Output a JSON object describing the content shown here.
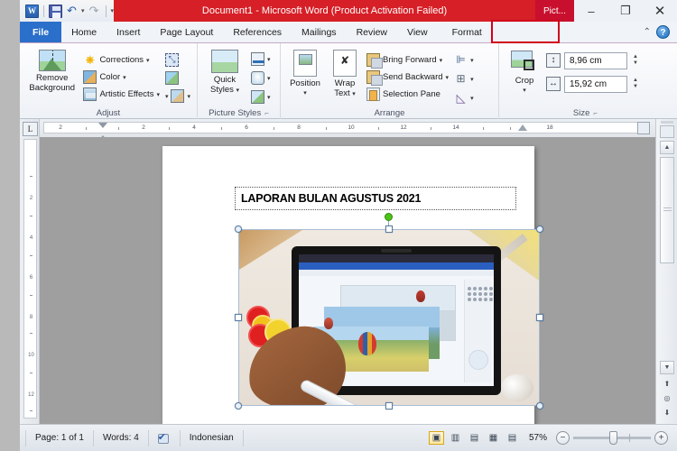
{
  "window": {
    "title": "Document1  -  Microsoft Word (Product Activation Failed)",
    "contextual_tab_group": "Pict...",
    "minimize": "–",
    "maximize": "❐",
    "close": "✕"
  },
  "quick_access": {
    "word_logo": "W",
    "save": "save-icon",
    "undo": "↶",
    "undo_caret": "▾",
    "redo": "↷",
    "customize_caret": "▾"
  },
  "tabs": [
    {
      "label": "File",
      "id": "file"
    },
    {
      "label": "Home",
      "id": "home"
    },
    {
      "label": "Insert",
      "id": "insert"
    },
    {
      "label": "Page Layout",
      "id": "page-layout"
    },
    {
      "label": "References",
      "id": "references"
    },
    {
      "label": "Mailings",
      "id": "mailings"
    },
    {
      "label": "Review",
      "id": "review"
    },
    {
      "label": "View",
      "id": "view"
    },
    {
      "label": "Format",
      "id": "format"
    }
  ],
  "tabstrip_right": {
    "minimize_ribbon": "⌃",
    "help": "?"
  },
  "ribbon": {
    "groups": [
      {
        "label": "Adjust",
        "big_button": "Remove\nBackground",
        "big_button_line1": "Remove",
        "big_button_line2": "Background",
        "items": [
          {
            "label": "Corrections",
            "caret": "▾"
          },
          {
            "label": "Color",
            "caret": "▾"
          },
          {
            "label": "Artistic Effects",
            "caret": "▾"
          }
        ],
        "side_icons": [
          "compress-pictures-icon",
          "change-picture-icon",
          "reset-picture-icon"
        ],
        "side_caret": "▾"
      },
      {
        "label": "Picture Styles",
        "quick_styles_line1": "Quick",
        "quick_styles_line2": "Styles",
        "quick_styles_caret": "▾",
        "side_items": [
          {
            "name": "picture-border",
            "caret": "▾"
          },
          {
            "name": "picture-effects",
            "caret": "▾"
          },
          {
            "name": "picture-layout",
            "caret": "▾"
          }
        ],
        "dialog_launcher": "⌐"
      },
      {
        "label": "Arrange",
        "position_line1": "Position",
        "position_caret": "▾",
        "wrap_line1": "Wrap",
        "wrap_line2": "Text",
        "wrap_caret": "▾",
        "items": [
          {
            "label": "Bring Forward",
            "caret": "▾"
          },
          {
            "label": "Send Backward",
            "caret": "▾"
          },
          {
            "label": "Selection Pane",
            "caret": ""
          }
        ],
        "side_items": [
          {
            "name": "align",
            "caret": "▾"
          },
          {
            "name": "group",
            "caret": "▾"
          },
          {
            "name": "rotate",
            "caret": "▾"
          }
        ]
      },
      {
        "label": "Size",
        "crop_label": "Crop",
        "crop_caret": "▾",
        "height_value": "8,96 cm",
        "width_value": "15,92 cm",
        "spin_up": "▲",
        "spin_down": "▼",
        "dialog_launcher": "⌐"
      }
    ]
  },
  "rulers": {
    "tab_selector": "L",
    "horizontal_ticks": [
      "2",
      "",
      "",
      "2",
      "",
      "4",
      "",
      "6",
      "",
      "8",
      "",
      "10",
      "",
      "12",
      "",
      "14",
      "",
      "",
      "18"
    ],
    "horizontal_labels": [
      "2",
      "2",
      "4",
      "6",
      "8",
      "10",
      "12",
      "14",
      "18"
    ],
    "vertical_labels": [
      "2",
      "4",
      "6",
      "8",
      "10",
      "12"
    ]
  },
  "document": {
    "title_text": "LAPORAN BULAN AGUSTUS 2021",
    "image_alt": "surface-tablet-stylus-hot-air-balloon-photo"
  },
  "scrollbar": {
    "up_arrow": "▲",
    "down_arrow": "▼",
    "previous_page": "⬆",
    "select_browse_object": "◎",
    "next_page": "⬇",
    "browse_object_icon": "select-browse-object-icon"
  },
  "statusbar": {
    "page": "Page: 1 of 1",
    "words": "Words: 4",
    "proofing_icon": "proofing-errors-icon",
    "language": "Indonesian",
    "views": [
      {
        "id": "print-layout",
        "glyph": "▣",
        "active": true
      },
      {
        "id": "full-screen-reading",
        "glyph": "▥",
        "active": false
      },
      {
        "id": "web-layout",
        "glyph": "▤",
        "active": false
      },
      {
        "id": "outline",
        "glyph": "▦",
        "active": false
      },
      {
        "id": "draft",
        "glyph": "▤",
        "active": false
      }
    ],
    "zoom_level": "57%",
    "zoom_out": "−",
    "zoom_in": "+"
  },
  "colors": {
    "titlebar_red": "#d61f26",
    "contextual_tab_red": "#c8102e",
    "file_tab_blue": "#2a6fc9",
    "highlight_red": "#d0021b"
  }
}
